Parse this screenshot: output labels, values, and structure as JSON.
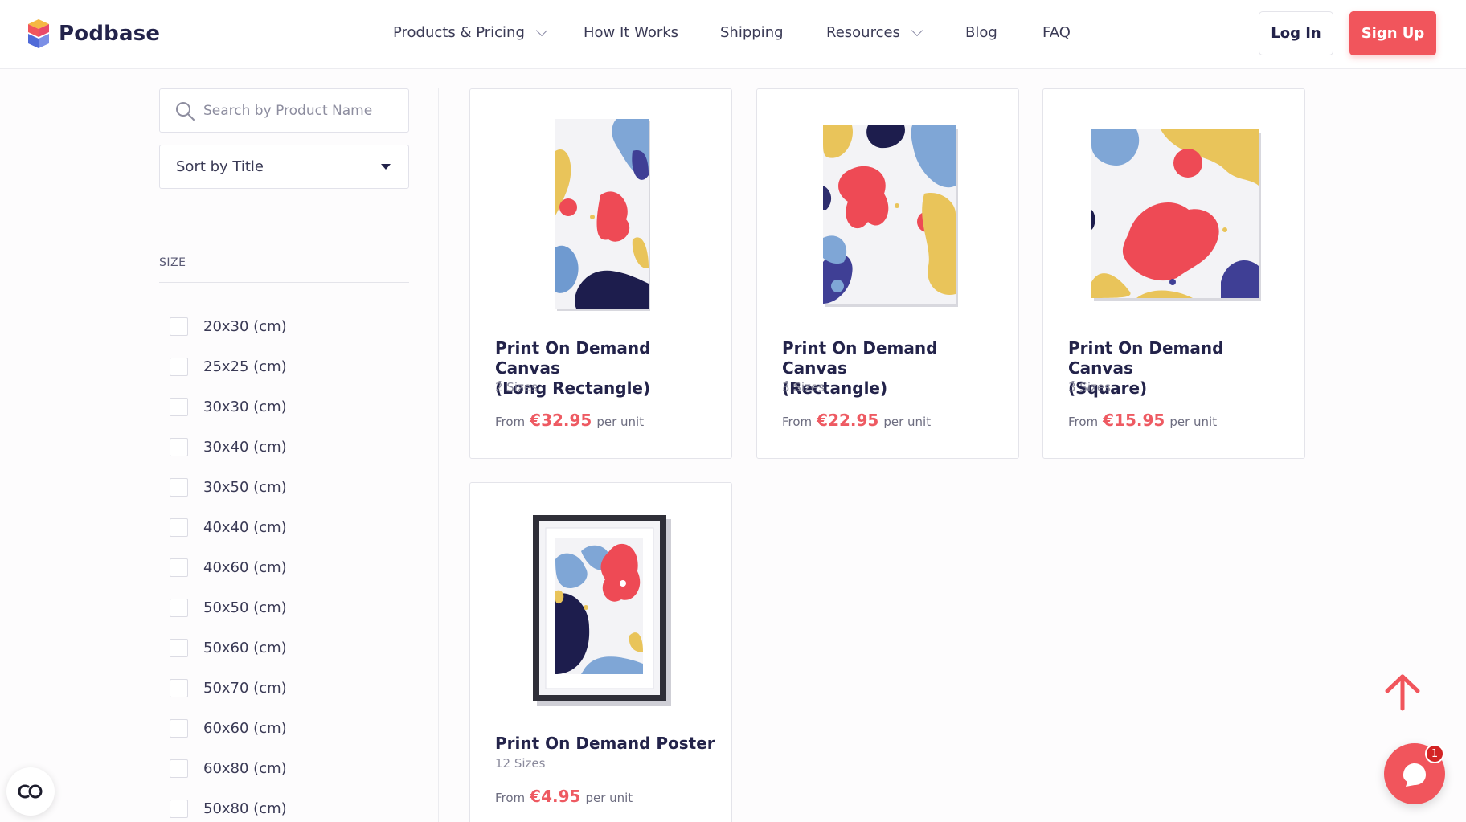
{
  "brand": {
    "name": "Podbase",
    "accent": "#f1555c",
    "navy": "#23234a"
  },
  "nav": {
    "items": [
      {
        "label": "Products & Pricing",
        "has_dropdown": true
      },
      {
        "label": "How It Works",
        "has_dropdown": false
      },
      {
        "label": "Shipping",
        "has_dropdown": false
      },
      {
        "label": "Resources",
        "has_dropdown": true
      },
      {
        "label": "Blog",
        "has_dropdown": false
      },
      {
        "label": "FAQ",
        "has_dropdown": false
      }
    ],
    "login_label": "Log In",
    "signup_label": "Sign Up"
  },
  "sidebar": {
    "search_placeholder": "Search by Product Name",
    "sort_label": "Sort by Title",
    "size_heading": "SIZE",
    "sizes": [
      "20x30 (cm)",
      "25x25 (cm)",
      "30x30 (cm)",
      "30x40 (cm)",
      "30x50 (cm)",
      "40x40 (cm)",
      "40x60 (cm)",
      "50x50 (cm)",
      "50x60 (cm)",
      "50x70 (cm)",
      "60x60 (cm)",
      "60x80 (cm)",
      "50x80 (cm)"
    ]
  },
  "products": [
    {
      "title_line1": "Print On Demand Canvas",
      "title_line2": "(Long Rectangle)",
      "sizes": "2 Sizes",
      "from": "From",
      "price": "€32.95",
      "per": "per unit"
    },
    {
      "title_line1": "Print On Demand Canvas",
      "title_line2": "(Rectangle)",
      "sizes": "3 Sizes",
      "from": "From",
      "price": "€22.95",
      "per": "per unit"
    },
    {
      "title_line1": "Print On Demand Canvas",
      "title_line2": "(Square)",
      "sizes": "3 Sizes",
      "from": "From",
      "price": "€15.95",
      "per": "per unit"
    },
    {
      "title_line1": "Print On Demand Poster",
      "title_line2": "",
      "sizes": "12 Sizes",
      "from": "From",
      "price": "€4.95",
      "per": "per unit"
    }
  ],
  "chat": {
    "badge": "1"
  },
  "icons": [
    "logo-icon",
    "search-icon",
    "chevron-down-icon",
    "caret-down-icon",
    "arrow-up-icon",
    "chat-icon",
    "accessibility-icon"
  ]
}
